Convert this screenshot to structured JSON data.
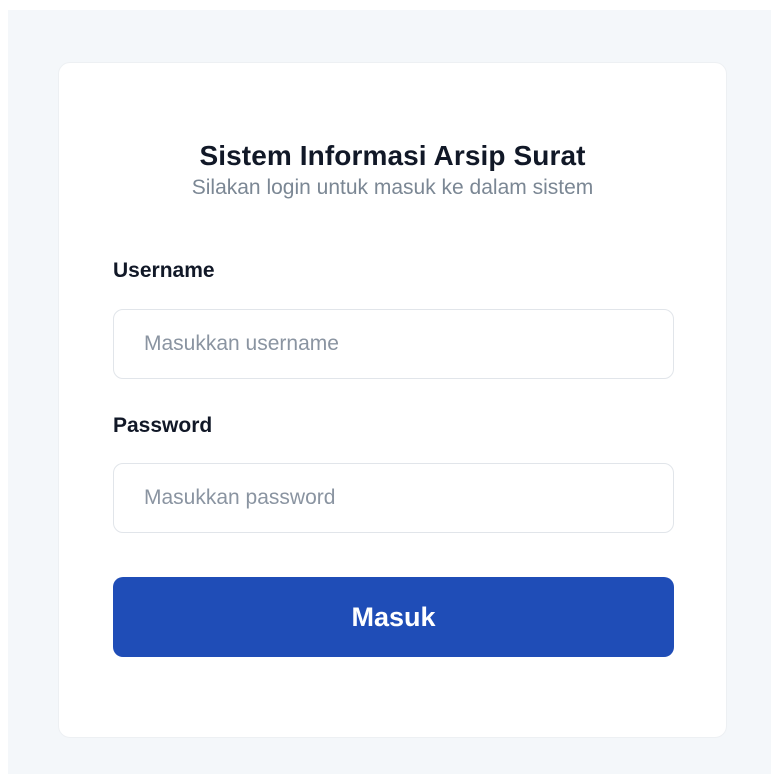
{
  "login": {
    "title": "Sistem Informasi Arsip Surat",
    "subtitle": "Silakan login untuk masuk ke dalam sistem",
    "username": {
      "label": "Username",
      "placeholder": "Masukkan username",
      "value": ""
    },
    "password": {
      "label": "Password",
      "placeholder": "Masukkan password",
      "value": ""
    },
    "submit_label": "Masuk"
  },
  "colors": {
    "page_background": "#f4f7fa",
    "card_background": "#ffffff",
    "primary_button": "#1f4db7",
    "heading_text": "#111827",
    "muted_text": "#7b8794",
    "input_border": "#e1e5ea"
  }
}
